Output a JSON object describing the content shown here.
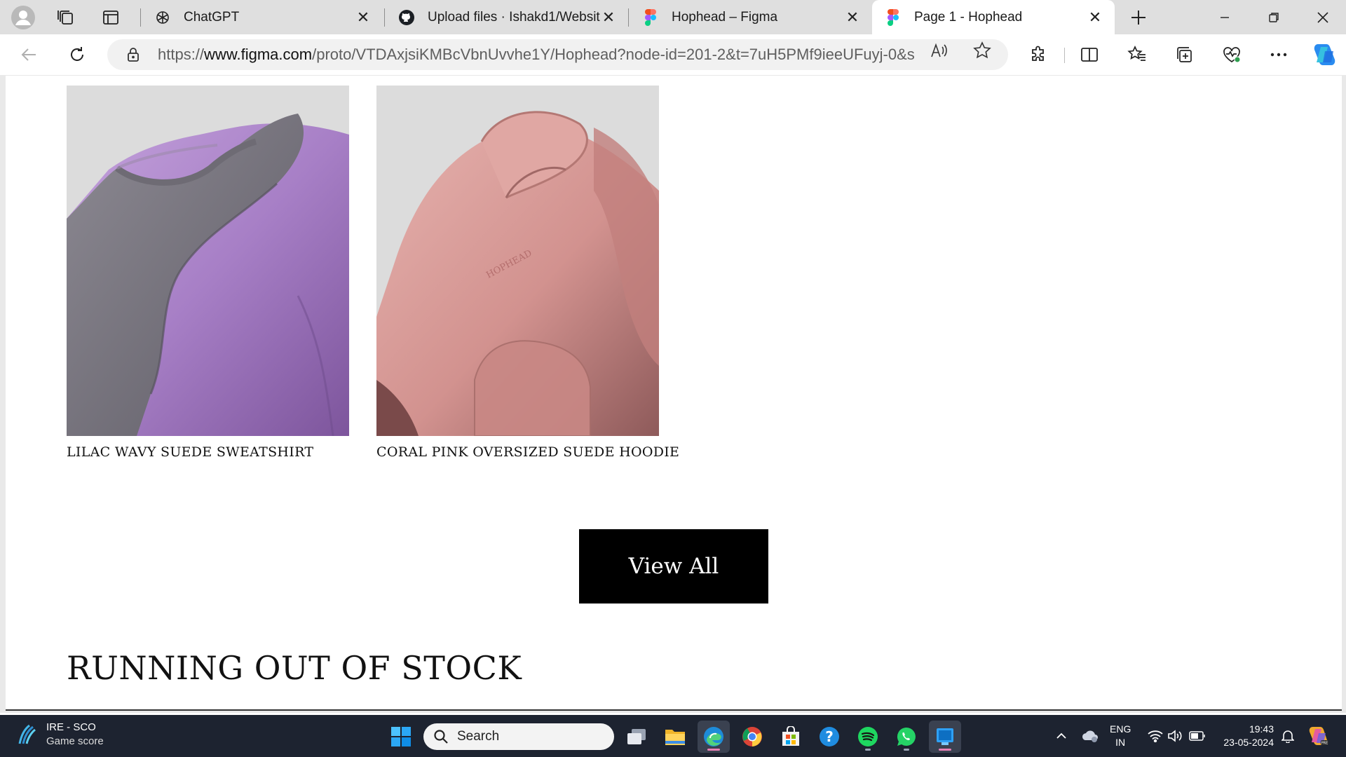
{
  "browser": {
    "tabs": [
      {
        "label": "ChatGPT",
        "favicon": "chatgpt-icon"
      },
      {
        "label": "Upload files · Ishakd1/Website",
        "favicon": "github-icon"
      },
      {
        "label": "Hophead – Figma",
        "favicon": "figma-icon"
      },
      {
        "label": "Page 1 - Hophead",
        "favicon": "figma-icon",
        "active": true
      }
    ],
    "url_prefix": "https://",
    "url_domain": "www.figma.com",
    "url_path": "/proto/VTDAxjsiKMBcVbnUvvhe1Y/Hophead?node-id=201-2&t=7uH5PMf9ieeUFuyj-0&s..."
  },
  "page": {
    "products": [
      {
        "title": "LILAC WAVY SUEDE SWEATSHIRT",
        "image": "lilac-sweatshirt-photo"
      },
      {
        "title": "CORAL PINK OVERSIZED SUEDE HOODIE",
        "image": "coral-hoodie-photo"
      }
    ],
    "hoodie_print": "HOPHEAD",
    "view_all_label": "View All",
    "section_title": "RUNNING OUT OF STOCK"
  },
  "taskbar": {
    "widget_line1": "IRE - SCO",
    "widget_line2": "Game score",
    "search_placeholder": "Search",
    "lang_line1": "ENG",
    "lang_line2": "IN",
    "time": "19:43",
    "date": "23-05-2024"
  },
  "colors": {
    "tabstrip": "#dfdfdf",
    "taskbar": "#1d2330",
    "button_black": "#000000",
    "lilac": "#a77fc6",
    "coral": "#d89a98"
  }
}
